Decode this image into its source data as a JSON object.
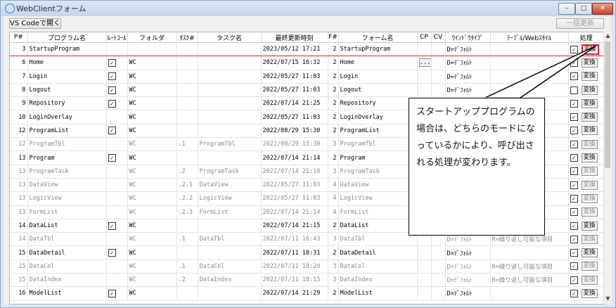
{
  "window": {
    "title": "WebClientフォーム",
    "minimize": "–",
    "maximize": "□",
    "close": "✕"
  },
  "toolbar": {
    "vscode_label": "VS Codeで開く",
    "bulk_update_label": "一括更新"
  },
  "columns": [
    "P#",
    "プログラム名",
    "ﾙｰﾄｺｰﾙ",
    "フォルダ",
    "ﾀｽｸ#",
    "タスク名",
    "最終更新時刻",
    "F#",
    "フォーム名",
    "CP",
    "CV",
    "ｳｲﾝﾄﾞｳﾀｲﾌﾟ",
    "ﾃｰﾌﾞﾙ/Webｽﾀｲﾙ",
    "処理"
  ],
  "rows": [
    {
      "p": "3",
      "program": "StartupProgram",
      "root": false,
      "folder": "",
      "task_no": "",
      "task": "",
      "updated": "2023/05/12 17:21",
      "f": "2",
      "form": "StartupProgram",
      "cp": false,
      "wtype": "D=ﾃﾞﾌｫﾙﾄ",
      "style": "",
      "dim": false,
      "hl": true
    },
    {
      "p": "6",
      "program": "Home",
      "root": true,
      "folder": "WC",
      "task_no": "",
      "task": "",
      "updated": "2022/07/15 16:32",
      "f": "2",
      "form": "Home",
      "cp": true,
      "wtype": "D=ﾃﾞﾌｫﾙﾄ",
      "style": "",
      "dim": false,
      "hl": false
    },
    {
      "p": "7",
      "program": "Login",
      "root": true,
      "folder": "WC",
      "task_no": "",
      "task": "",
      "updated": "2022/05/27 11:03",
      "f": "2",
      "form": "Login",
      "cp": false,
      "wtype": "D=ﾃﾞﾌｫﾙﾄ",
      "style": "",
      "dim": false,
      "hl": false
    },
    {
      "p": "8",
      "program": "Logout",
      "root": true,
      "folder": "WC",
      "task_no": "",
      "task": "",
      "updated": "2022/05/27 11:03",
      "f": "2",
      "form": "Logout",
      "cp": false,
      "wtype": "D=ﾃﾞﾌｫﾙﾄ",
      "style": "",
      "dim": false,
      "hl": false
    },
    {
      "p": "9",
      "program": "Repository",
      "root": true,
      "folder": "WC",
      "task_no": "",
      "task": "",
      "updated": "2022/07/14 21:25",
      "f": "2",
      "form": "Repository",
      "cp": false,
      "wtype": "",
      "style": "",
      "dim": false,
      "hl": false
    },
    {
      "p": "10",
      "program": "LoginOverlay",
      "root": false,
      "folder": "WC",
      "task_no": "",
      "task": "",
      "updated": "2022/05/27 11:03",
      "f": "2",
      "form": "LoginOverlay",
      "cp": false,
      "wtype": "",
      "style": "",
      "dim": false,
      "hl": false
    },
    {
      "p": "12",
      "program": "ProgramList",
      "root": true,
      "folder": "WC",
      "task_no": "",
      "task": "",
      "updated": "2022/08/29 15:30",
      "f": "2",
      "form": "ProgramList",
      "cp": false,
      "wtype": "",
      "style": "",
      "dim": false,
      "hl": false
    },
    {
      "p": "12",
      "program": "ProgramTbl",
      "root": false,
      "folder": "WC",
      "task_no": ".1",
      "task": "ProgramTbl",
      "updated": "2022/08/29 15:30",
      "f": "3",
      "form": "ProgramTbl",
      "cp": false,
      "wtype": "",
      "style": "",
      "dim": true,
      "hl": false
    },
    {
      "p": "13",
      "program": "Program",
      "root": true,
      "folder": "WC",
      "task_no": "",
      "task": "",
      "updated": "2022/07/14 21:14",
      "f": "2",
      "form": "Program",
      "cp": false,
      "wtype": "",
      "style": "",
      "dim": false,
      "hl": false
    },
    {
      "p": "13",
      "program": "ProgramTask",
      "root": false,
      "folder": "WC",
      "task_no": ".2",
      "task": "ProgramTask",
      "updated": "2022/07/14 21:10",
      "f": "3",
      "form": "ProgramTask",
      "cp": false,
      "wtype": "",
      "style": "",
      "dim": true,
      "hl": false
    },
    {
      "p": "13",
      "program": "DataView",
      "root": false,
      "folder": "WC",
      "task_no": ".2.1",
      "task": "DataView",
      "updated": "2022/05/27 11:03",
      "f": "4",
      "form": "DataView",
      "cp": false,
      "wtype": "",
      "style": "",
      "dim": true,
      "hl": false
    },
    {
      "p": "13",
      "program": "LogicView",
      "root": false,
      "folder": "WC",
      "task_no": ".2.2",
      "task": "LogicView",
      "updated": "2022/05/27 11:03",
      "f": "4",
      "form": "LogicView",
      "cp": false,
      "wtype": "",
      "style": "",
      "dim": true,
      "hl": false
    },
    {
      "p": "13",
      "program": "FormList",
      "root": false,
      "folder": "WC",
      "task_no": ".2.3",
      "task": "FormList",
      "updated": "2022/07/14 21:14",
      "f": "4",
      "form": "FormList",
      "cp": false,
      "wtype": "",
      "style": "",
      "dim": true,
      "hl": false
    },
    {
      "p": "14",
      "program": "DataList",
      "root": true,
      "folder": "WC",
      "task_no": "",
      "task": "",
      "updated": "2022/07/14 21:15",
      "f": "2",
      "form": "DataList",
      "cp": false,
      "wtype": "",
      "style": "",
      "dim": false,
      "hl": false
    },
    {
      "p": "14",
      "program": "DataTbl",
      "root": false,
      "folder": "WC",
      "task_no": ".1",
      "task": "DataTbl",
      "updated": "2022/07/11 16:43",
      "f": "3",
      "form": "DataTbl",
      "cp": false,
      "wtype": "D=ﾃﾞﾌｫﾙﾄ",
      "style": "R=繰り返し可能な項目",
      "dim": true,
      "hl": false
    },
    {
      "p": "15",
      "program": "DataDetail",
      "root": true,
      "folder": "WC",
      "task_no": "",
      "task": "",
      "updated": "2022/07/11 18:31",
      "f": "2",
      "form": "DataDetail",
      "cp": false,
      "wtype": "D=ﾃﾞﾌｫﾙﾄ",
      "style": "",
      "dim": false,
      "hl": false
    },
    {
      "p": "15",
      "program": "DataCol",
      "root": false,
      "folder": "WC",
      "task_no": ".1",
      "task": "DataCol",
      "updated": "2022/07/11 18:20",
      "f": "3",
      "form": "DataCol",
      "cp": false,
      "wtype": "D=ﾃﾞﾌｫﾙﾄ",
      "style": "R=繰り返し可能な項目",
      "dim": true,
      "hl": false
    },
    {
      "p": "15",
      "program": "DataIndex",
      "root": false,
      "folder": "WC",
      "task_no": ".2",
      "task": "DataIndex",
      "updated": "2022/07/11 18:15",
      "f": "3",
      "form": "DataIndex",
      "cp": false,
      "wtype": "D=ﾃﾞﾌｫﾙﾄ",
      "style": "R=繰り返し可能な項目",
      "dim": true,
      "hl": false
    },
    {
      "p": "16",
      "program": "ModelList",
      "root": true,
      "folder": "WC",
      "task_no": "",
      "task": "",
      "updated": "2022/07/14 21:29",
      "f": "2",
      "form": "ModelList",
      "cp": false,
      "wtype": "D=ﾃﾞﾌｫﾙﾄ",
      "style": "",
      "dim": false,
      "hl": false
    }
  ],
  "process_checked": [
    true,
    true,
    true,
    false,
    true,
    true,
    true,
    true,
    true,
    true,
    true,
    true,
    true,
    true,
    true,
    true,
    true,
    true,
    true
  ],
  "convert_label": "変換",
  "cp_button_label": "...",
  "check_mark": "✓",
  "callout_text": "スタートアッププログラムの場合は、どちらのモードになっているかにより、呼び出される処理が変わります。",
  "colors": {
    "highlight_red": "#e0212d",
    "dim_text": "#8a8a8a",
    "title_bar": "#c6d6ec"
  },
  "icons": [
    "app-icon",
    "minimize-icon",
    "maximize-icon",
    "close-icon",
    "scroll-up-icon",
    "scroll-down-icon"
  ]
}
